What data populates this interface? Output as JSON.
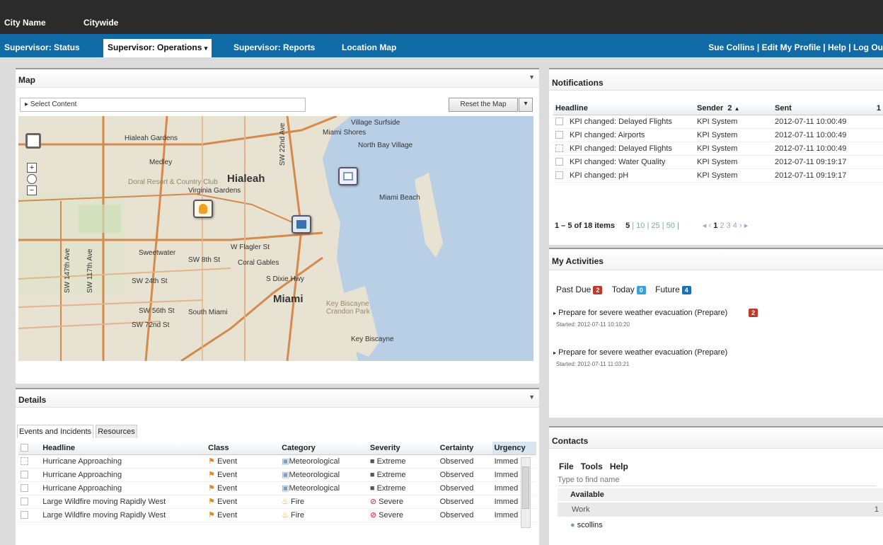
{
  "topbar": {
    "city": "City Name",
    "scope": "Citywide"
  },
  "nav": {
    "tabs": [
      "Supervisor: Status",
      "Supervisor: Operations",
      "Supervisor: Reports",
      "Location Map"
    ],
    "user": "Sue Collins",
    "edit_profile": "Edit My Profile",
    "help": "Help",
    "logout": "Log Ou"
  },
  "map": {
    "title": "Map",
    "select_content": "Select Content",
    "reset": "Reset the Map",
    "labels": {
      "hialeah": "Hialeah",
      "miami": "Miami",
      "hialeah_gardens": "Hialeah Gardens",
      "medley": "Medley",
      "doral": "Doral Resort & Country Club",
      "virginia_gardens": "Virginia Gardens",
      "miami_shores": "Miami Shores",
      "north_bay": "North Bay Village",
      "miami_beach": "Miami Beach",
      "sweetwater": "Sweetwater",
      "coral_gables": "Coral Gables",
      "south_miami": "South Miami",
      "key_biscayne": "Key Biscayne",
      "key_biscayne_park": "Key Biscayne Crandon Park",
      "surfside": "Village Surfside",
      "flagler": "W Flagler St",
      "sw_8th": "SW 8th St",
      "sw_24th": "SW 24th St",
      "sw_56th": "SW 56th St",
      "sw_72nd": "SW 72nd St",
      "sw_147": "SW 147th Ave",
      "sw_117": "SW 117th Ave",
      "sw_22nd": "SW 22nd Ave",
      "dixie": "S Dixie Hwy"
    }
  },
  "details": {
    "title": "Details",
    "tabs": [
      "Events and Incidents",
      "Resources"
    ],
    "columns": [
      "Headline",
      "Class",
      "Category",
      "Severity",
      "Certainty",
      "Urgency"
    ],
    "rows": [
      {
        "headline": "Hurricane Approaching",
        "class": "Event",
        "category": "Meteorological",
        "severity": "Extreme",
        "certainty": "Observed",
        "urgency": "Immed"
      },
      {
        "headline": "Hurricane Approaching",
        "class": "Event",
        "category": "Meteorological",
        "severity": "Extreme",
        "certainty": "Observed",
        "urgency": "Immed"
      },
      {
        "headline": "Hurricane Approaching",
        "class": "Event",
        "category": "Meteorological",
        "severity": "Extreme",
        "certainty": "Observed",
        "urgency": "Immed"
      },
      {
        "headline": "Large Wildfire moving Rapidly West",
        "class": "Event",
        "category": "Fire",
        "severity": "Severe",
        "certainty": "Observed",
        "urgency": "Immed"
      },
      {
        "headline": "Large Wildfire moving Rapidly West",
        "class": "Event",
        "category": "Fire",
        "severity": "Severe",
        "certainty": "Observed",
        "urgency": "Immed"
      }
    ]
  },
  "notifications": {
    "title": "Notifications",
    "columns": {
      "headline": "Headline",
      "sender": "Sender",
      "sender_sort": "2",
      "sent": "Sent",
      "sent_sort": "1"
    },
    "rows": [
      {
        "headline": "KPI changed: Delayed Flights",
        "sender": "KPI System",
        "sent": "2012-07-11 10:00:49"
      },
      {
        "headline": "KPI changed: Airports",
        "sender": "KPI System",
        "sent": "2012-07-11 10:00:49"
      },
      {
        "headline": "KPI changed: Delayed Flights",
        "sender": "KPI System",
        "sent": "2012-07-11 10:00:49"
      },
      {
        "headline": "KPI changed: Water Quality",
        "sender": "KPI System",
        "sent": "2012-07-11 09:19:17"
      },
      {
        "headline": "KPI changed: pH",
        "sender": "KPI System",
        "sent": "2012-07-11 09:19:17"
      }
    ],
    "pager_range": "1 – 5 of 18 items",
    "page_sizes": [
      "5",
      "10",
      "25",
      "50"
    ],
    "pages": [
      "1",
      "2",
      "3",
      "4"
    ]
  },
  "activities": {
    "title": "My Activities",
    "past_due": "Past Due",
    "past_due_count": "2",
    "today": "Today",
    "today_count": "0",
    "future": "Future",
    "future_count": "4",
    "items": [
      {
        "title": "Prepare for severe weather evacuation (Prepare)",
        "started": "Started: 2012-07-11 10:10:20",
        "badge": "2"
      },
      {
        "title": "Prepare for severe weather evacuation (Prepare)",
        "started": "Started: 2012-07-11 11:03:21"
      }
    ]
  },
  "contacts": {
    "title": "Contacts",
    "menu": [
      "File",
      "Tools",
      "Help"
    ],
    "placeholder": "Type to find name",
    "available": "Available",
    "group": "Work",
    "group_count": "1",
    "contact": "scollins"
  },
  "colors": {
    "nav": "#0f6aa5",
    "topbar": "#2b2b2b",
    "pastdue": "#c0392b",
    "today": "#3aa0dd",
    "future": "#1f6fb0"
  }
}
